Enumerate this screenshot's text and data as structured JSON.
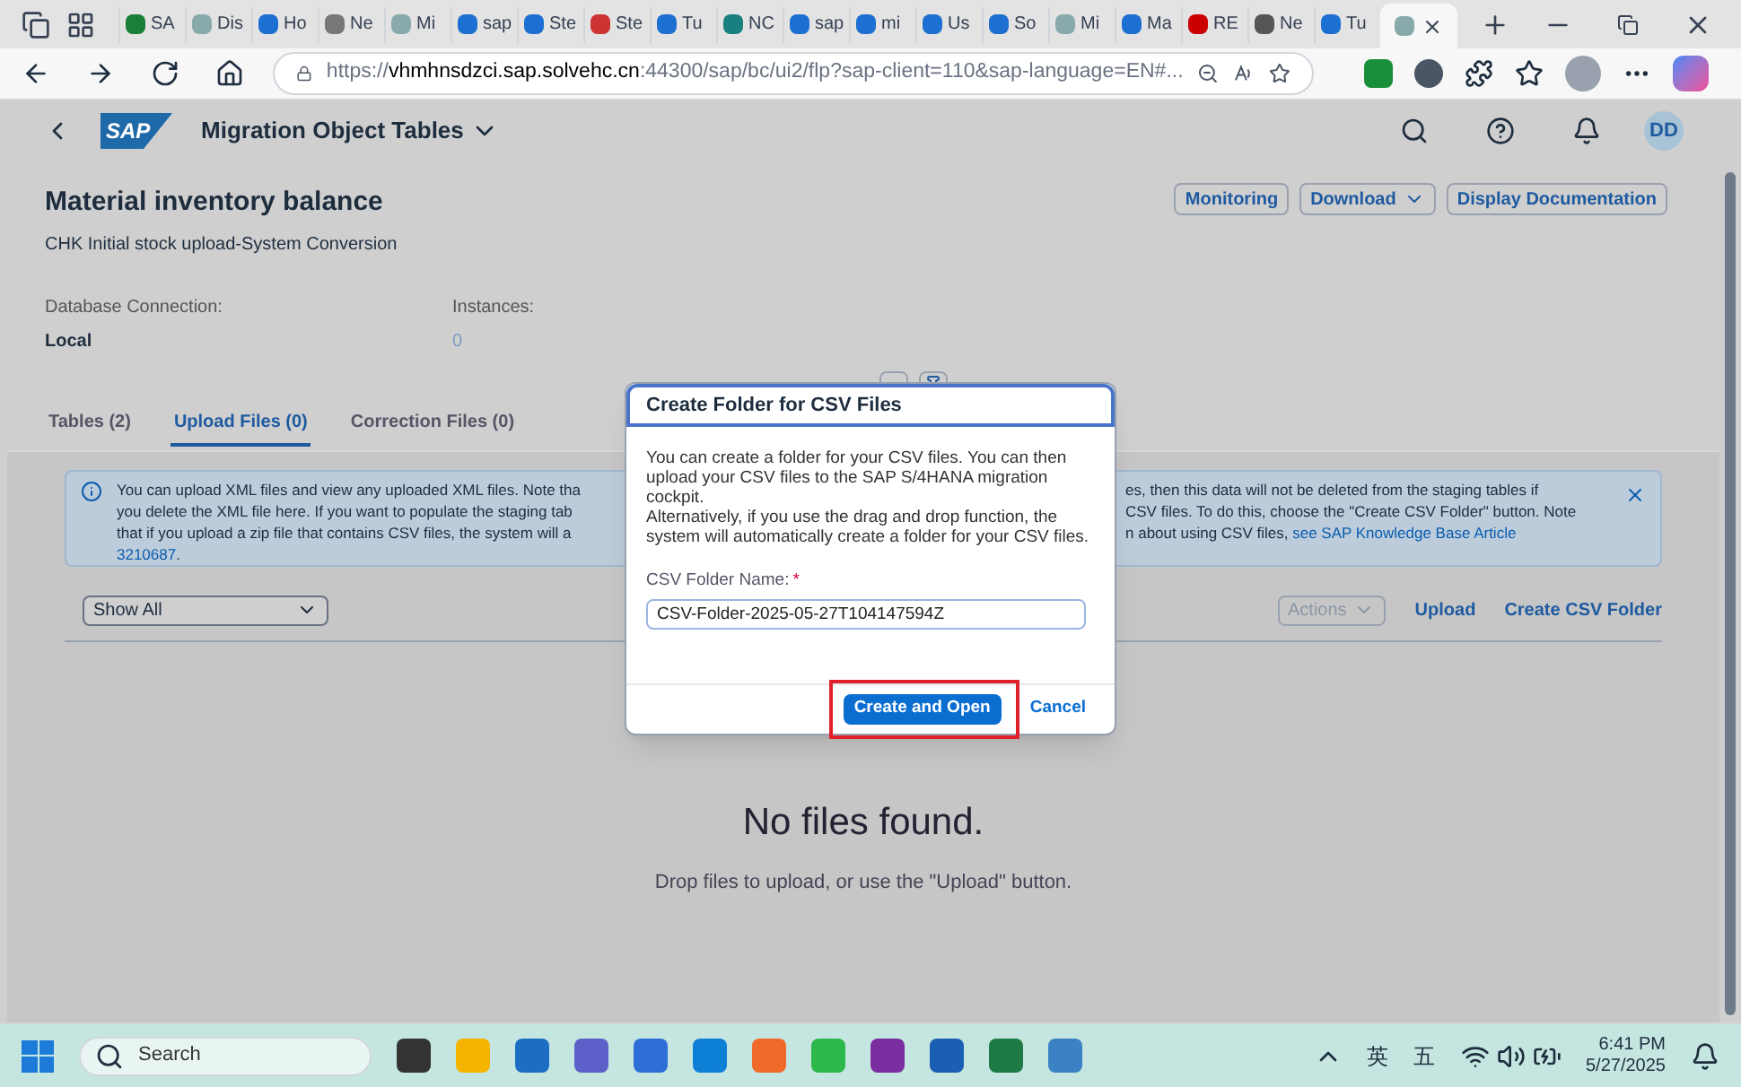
{
  "browser": {
    "tabs": [
      {
        "label": "SA",
        "selected": false
      },
      {
        "label": "Dis",
        "selected": false
      },
      {
        "label": "Ho",
        "selected": false
      },
      {
        "label": "Ne",
        "selected": false
      },
      {
        "label": "Mi",
        "selected": false
      },
      {
        "label": "sap",
        "selected": false
      },
      {
        "label": "Ste",
        "selected": false
      },
      {
        "label": "Ste",
        "selected": false
      },
      {
        "label": "Tu",
        "selected": false
      },
      {
        "label": "NC",
        "selected": false
      },
      {
        "label": "sap",
        "selected": false
      },
      {
        "label": "mi",
        "selected": false
      },
      {
        "label": "Us",
        "selected": false
      },
      {
        "label": "So",
        "selected": false
      },
      {
        "label": "Mi",
        "selected": false
      },
      {
        "label": "Ma",
        "selected": false
      },
      {
        "label": "RE",
        "selected": false
      },
      {
        "label": "Ne",
        "selected": false
      },
      {
        "label": "Tu",
        "selected": false
      },
      {
        "selected": true
      }
    ],
    "url_prefix": "https://",
    "url_host": "vhmhnsdzci.sap.solvehc.cn",
    "url_rest": ":44300/sap/bc/ui2/flp?sap-client=110&sap-language=EN#..."
  },
  "shell": {
    "logo": "SAP",
    "title": "Migration Object Tables",
    "avatar": "DD"
  },
  "header": {
    "title": "Material inventory balance",
    "subtitle": "CHK Initial stock upload-System Conversion",
    "actions": [
      {
        "label": "Monitoring",
        "kind": "button"
      },
      {
        "label": "Download",
        "kind": "menu"
      },
      {
        "label": "Display Documentation",
        "kind": "button"
      }
    ],
    "attributes": [
      {
        "label": "Database Connection:",
        "value": "Local",
        "kind": "text"
      },
      {
        "label": "Instances:",
        "value": "0",
        "kind": "link"
      }
    ]
  },
  "tabs": [
    {
      "label": "Tables (2)",
      "selected": false
    },
    {
      "label": "Upload Files (0)",
      "selected": true
    },
    {
      "label": "Correction Files (0)",
      "selected": false
    }
  ],
  "message": {
    "left_lines": [
      "You can upload XML files and view any uploaded XML files. Note tha",
      "you delete the XML file here. If you want to populate the staging tab",
      "that if you upload a zip file that contains CSV files, the system will a"
    ],
    "left_link": "3210687",
    "left_after": ".",
    "right_lines": [
      "es, then this data will not be deleted from the staging tables if",
      "CSV files. To do this, choose the \"Create CSV Folder\" button. Note",
      "n about using CSV files, "
    ],
    "right_link": "see SAP Knowledge Base Article"
  },
  "toolbar": {
    "filter": "Show All",
    "actions": [
      {
        "label": "Actions",
        "disabled": true,
        "kind": "menu"
      },
      {
        "label": "Upload",
        "disabled": false,
        "kind": "button"
      },
      {
        "label": "Create CSV Folder",
        "disabled": false,
        "kind": "button"
      }
    ]
  },
  "empty": {
    "title": "No files found.",
    "hint": "Drop files to upload, or use the \"Upload\" button."
  },
  "dialog": {
    "title": "Create Folder for CSV Files",
    "text": "You can create a folder for your CSV files. You can then upload your CSV files to the SAP S/4HANA migration cockpit.",
    "text2": "Alternatively, if you use the drag and drop function, the system will automatically create a folder for your CSV files.",
    "field_label": "CSV Folder Name:",
    "required": true,
    "required_mark": "*",
    "field_value": "CSV-Folder-2025-05-27T104147594Z",
    "primary": "Create and Open",
    "secondary": "Cancel",
    "highlighted": true
  },
  "taskbar": {
    "search": "Search",
    "ime1": "英",
    "ime2": "五",
    "time": "6:41 PM",
    "date": "5/27/2025"
  }
}
